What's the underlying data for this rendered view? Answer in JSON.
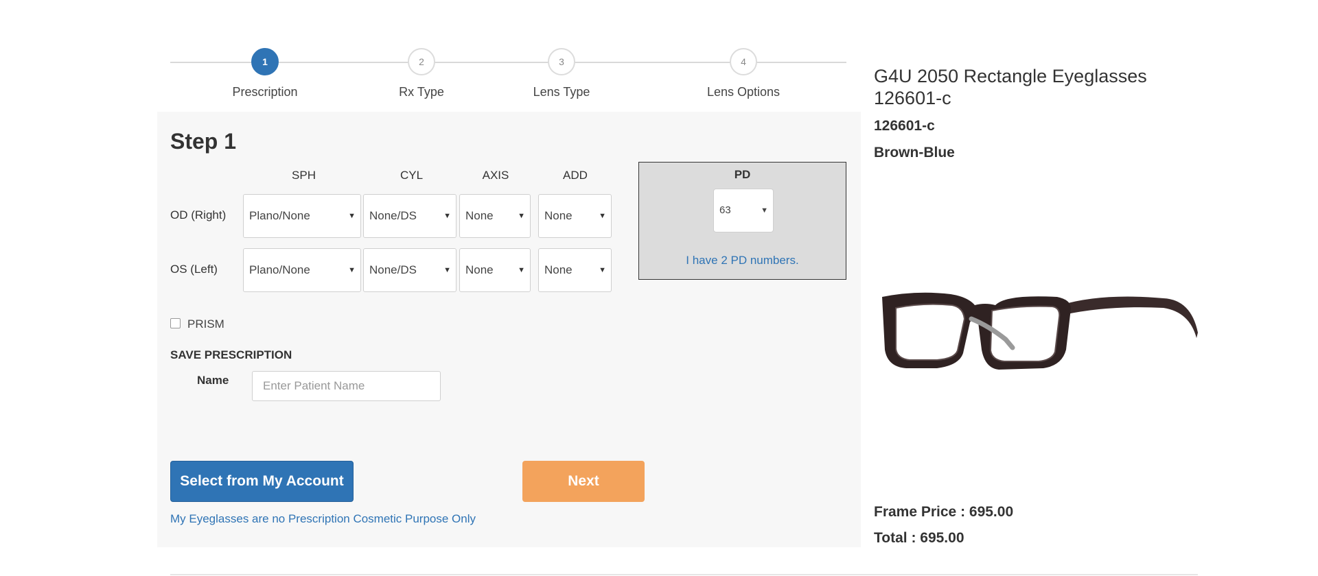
{
  "stepper": {
    "steps": [
      {
        "number": "1",
        "label": "Prescription",
        "active": true
      },
      {
        "number": "2",
        "label": "Rx Type",
        "active": false
      },
      {
        "number": "3",
        "label": "Lens Type",
        "active": false
      },
      {
        "number": "4",
        "label": "Lens Options",
        "active": false
      }
    ]
  },
  "form": {
    "title": "Step 1",
    "columns": [
      "SPH",
      "CYL",
      "AXIS",
      "ADD"
    ],
    "rows": [
      {
        "label": "OD (Right)",
        "sph": "Plano/None",
        "cyl": "None/DS",
        "axis": "None",
        "add": "None"
      },
      {
        "label": "OS (Left)",
        "sph": "Plano/None",
        "cyl": "None/DS",
        "axis": "None",
        "add": "None"
      }
    ],
    "pd": {
      "title": "PD",
      "value": "63",
      "link": "I have 2 PD numbers."
    },
    "prism_label": "PRISM",
    "save_title": "SAVE PRESCRIPTION",
    "name_label": "Name",
    "name_placeholder": "Enter Patient Name",
    "select_account_label": "Select from My Account",
    "next_label": "Next",
    "cosmetic_link": "My Eyeglasses are no Prescription Cosmetic Purpose Only"
  },
  "product": {
    "title": "G4U 2050 Rectangle Eyeglasses 126601-c",
    "sku": "126601-c",
    "color": "Brown-Blue",
    "frame_price": "Frame Price : 695.00",
    "total": "Total : 695.00"
  },
  "icons": {
    "dropdown": "chevron-down-icon",
    "checkbox": "checkbox-icon"
  },
  "colors": {
    "primary": "#2f74b5",
    "accent": "#f3a35c",
    "panel": "#f7f7f7",
    "pd_box": "#dcdcdc"
  }
}
